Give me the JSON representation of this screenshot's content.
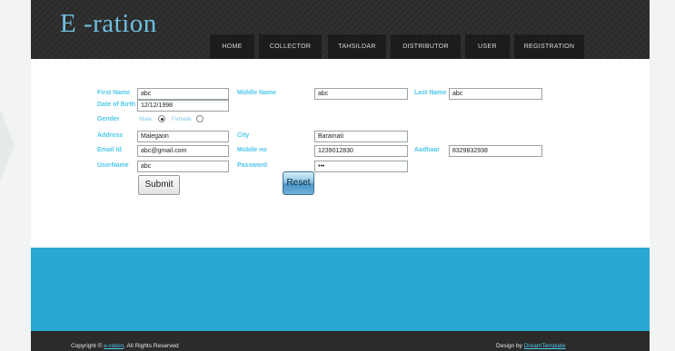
{
  "site": {
    "logo": "E -ration"
  },
  "nav": {
    "items": [
      {
        "label": "HOME"
      },
      {
        "label": "COLLECTOR"
      },
      {
        "label": "TAHSILDAR"
      },
      {
        "label": "DISTRIBUTOR"
      },
      {
        "label": "USER"
      },
      {
        "label": "REGISTRATION"
      }
    ]
  },
  "form": {
    "first_name": {
      "label": "First Name",
      "value": "abc"
    },
    "middle_name": {
      "label": "Middle Name",
      "value": "abc"
    },
    "last_name": {
      "label": "Last Name",
      "value": "abc"
    },
    "dob": {
      "label": "Date of Birth",
      "value": "12/12/1998"
    },
    "gender": {
      "label": "Gender",
      "male": "Male",
      "female": "Female",
      "selected": "Male"
    },
    "address": {
      "label": "Address",
      "value": "Malegaon"
    },
    "city": {
      "label": "City",
      "value": "Baramati"
    },
    "email": {
      "label": "Email Id",
      "value": "abc@gmail.com"
    },
    "mobile": {
      "label": "Mobile no",
      "value": "1239012830"
    },
    "aadhaar": {
      "label": "Aadhaar",
      "value": "8329832938"
    },
    "username": {
      "label": "UserName",
      "value": "abc"
    },
    "password": {
      "label": "Password",
      "value": "•••"
    },
    "submit_label": "Submit",
    "reset_label": "Reset"
  },
  "footer": {
    "copyright_prefix": "Copyright © ",
    "copyright_link": "e-ration",
    "copyright_suffix": ". All Rights Reserved",
    "design_prefix": "Design by ",
    "design_link": "DreamTemplate"
  },
  "colors": {
    "accent": "#4fc8ea",
    "header_bg": "#2b2b2b",
    "band": "#29a8d4",
    "logo": "#6fc0df"
  }
}
